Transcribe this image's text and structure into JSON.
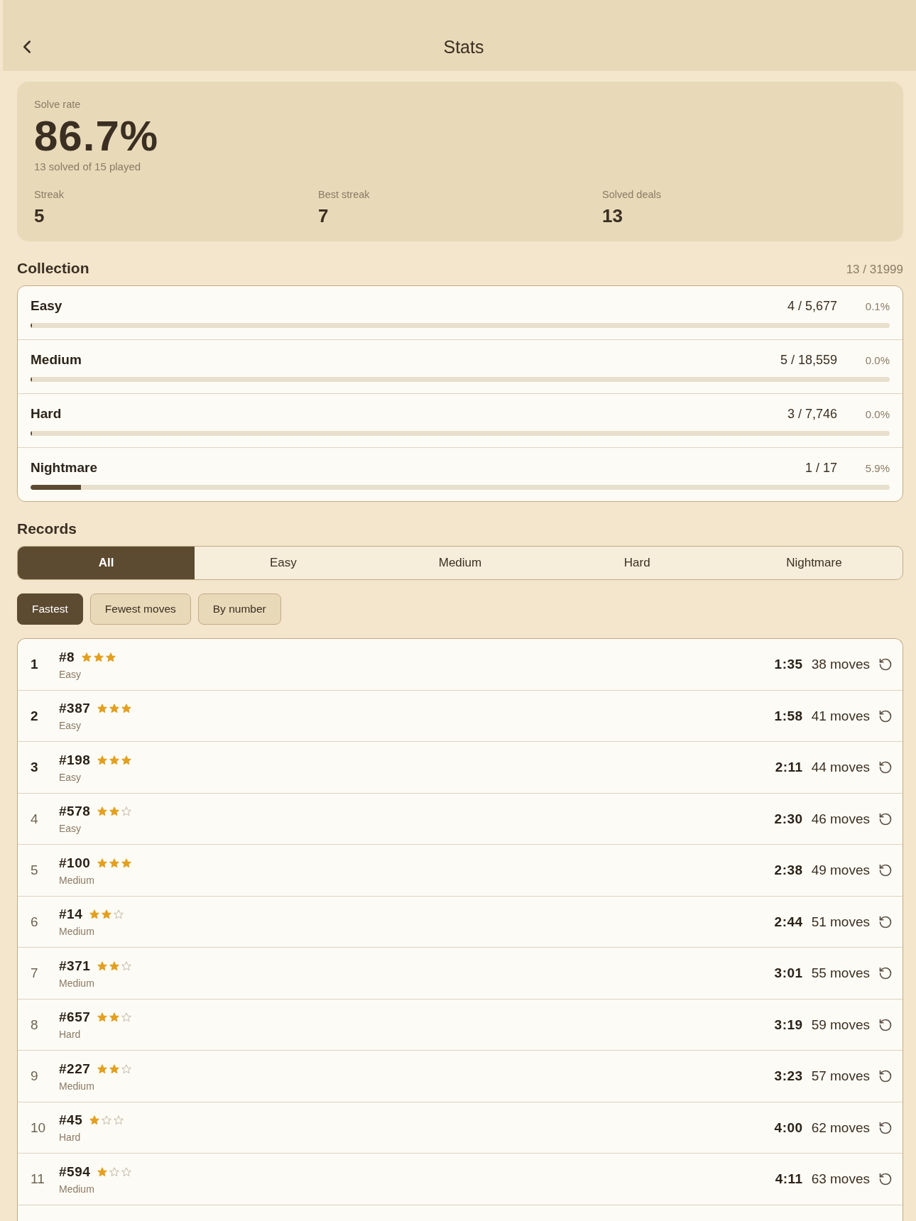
{
  "header": {
    "title": "Stats"
  },
  "summary": {
    "label": "Solve rate",
    "value": "86.7%",
    "caption": "13 solved of 15 played",
    "stats": [
      {
        "label": "Streak",
        "value": "5"
      },
      {
        "label": "Best streak",
        "value": "7"
      },
      {
        "label": "Solved deals",
        "value": "13"
      }
    ]
  },
  "collection": {
    "title": "Collection",
    "total": "13 / 31999",
    "rows": [
      {
        "name": "Easy",
        "count": "4 / 5,677",
        "percent": "0.1%",
        "level": 0.0007
      },
      {
        "name": "Medium",
        "count": "5 / 18,559",
        "percent": "0.0%",
        "level": 0.0003
      },
      {
        "name": "Hard",
        "count": "3 / 7,746",
        "percent": "0.0%",
        "level": 0.0004
      },
      {
        "name": "Nightmare",
        "count": "1 / 17",
        "percent": "5.9%",
        "level": 0.059
      }
    ]
  },
  "records": {
    "title": "Records",
    "tabs": [
      {
        "label": "All",
        "selected": true
      },
      {
        "label": "Easy",
        "selected": false
      },
      {
        "label": "Medium",
        "selected": false
      },
      {
        "label": "Hard",
        "selected": false
      },
      {
        "label": "Nightmare",
        "selected": false
      }
    ],
    "sorts": [
      {
        "label": "Fastest",
        "selected": true
      },
      {
        "label": "Fewest moves",
        "selected": false
      },
      {
        "label": "By number",
        "selected": false
      }
    ],
    "rows": [
      {
        "rank": "1",
        "top": true,
        "deal": "#8",
        "stars": 3,
        "difficulty": "Easy",
        "time": "1:35",
        "moves": "38 moves"
      },
      {
        "rank": "2",
        "top": true,
        "deal": "#387",
        "stars": 3,
        "difficulty": "Easy",
        "time": "1:58",
        "moves": "41 moves"
      },
      {
        "rank": "3",
        "top": true,
        "deal": "#198",
        "stars": 3,
        "difficulty": "Easy",
        "time": "2:11",
        "moves": "44 moves"
      },
      {
        "rank": "4",
        "top": false,
        "deal": "#578",
        "stars": 2,
        "difficulty": "Easy",
        "time": "2:30",
        "moves": "46 moves"
      },
      {
        "rank": "5",
        "top": false,
        "deal": "#100",
        "stars": 3,
        "difficulty": "Medium",
        "time": "2:38",
        "moves": "49 moves"
      },
      {
        "rank": "6",
        "top": false,
        "deal": "#14",
        "stars": 2,
        "difficulty": "Medium",
        "time": "2:44",
        "moves": "51 moves"
      },
      {
        "rank": "7",
        "top": false,
        "deal": "#371",
        "stars": 2,
        "difficulty": "Medium",
        "time": "3:01",
        "moves": "55 moves"
      },
      {
        "rank": "8",
        "top": false,
        "deal": "#657",
        "stars": 2,
        "difficulty": "Hard",
        "time": "3:19",
        "moves": "59 moves"
      },
      {
        "rank": "9",
        "top": false,
        "deal": "#227",
        "stars": 2,
        "difficulty": "Medium",
        "time": "3:23",
        "moves": "57 moves"
      },
      {
        "rank": "10",
        "top": false,
        "deal": "#45",
        "stars": 1,
        "difficulty": "Hard",
        "time": "4:00",
        "moves": "62 moves"
      },
      {
        "rank": "11",
        "top": false,
        "deal": "#594",
        "stars": 1,
        "difficulty": "Medium",
        "time": "4:11",
        "moves": "63 moves"
      }
    ]
  }
}
